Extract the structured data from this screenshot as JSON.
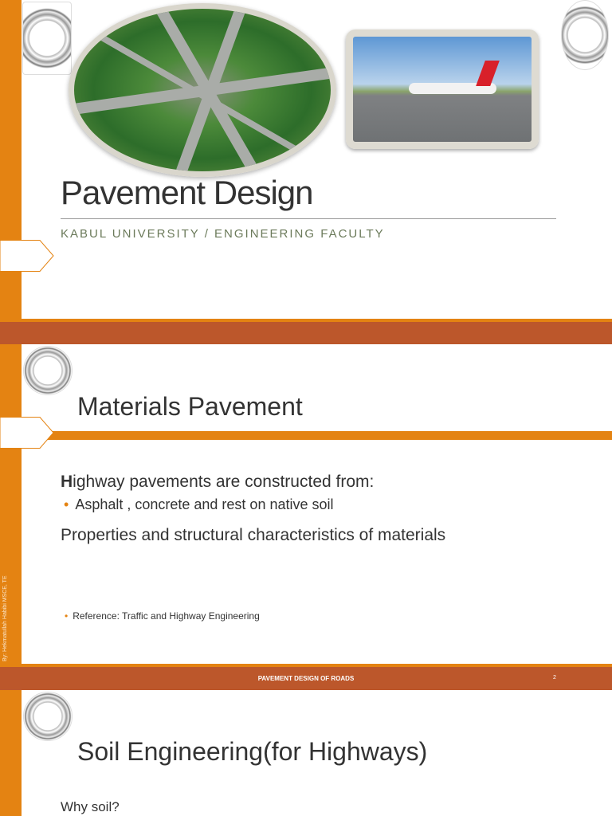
{
  "slide1": {
    "title": "Pavement Design",
    "subtitle": "KABUL UNIVERSITY / ENGINEERING FACULTY"
  },
  "slide2": {
    "title": "Materials Pavement",
    "para1_first": "H",
    "para1_rest": "ighway pavements are constructed from:",
    "bullet1": "Asphalt , concrete and rest on native soil",
    "para2": "Properties and structural characteristics of materials",
    "reference": "Reference: Traffic and Highway Engineering",
    "author": "By: Hekmatullah Habibi MSCE, TE",
    "footer": "PAVEMENT DESIGN OF ROADS",
    "page_number": "2"
  },
  "slide3": {
    "title": "Soil Engineering(for Highways)",
    "para1": "Why soil?"
  },
  "colors": {
    "accent": "#e48312",
    "band": "#bc572b"
  }
}
